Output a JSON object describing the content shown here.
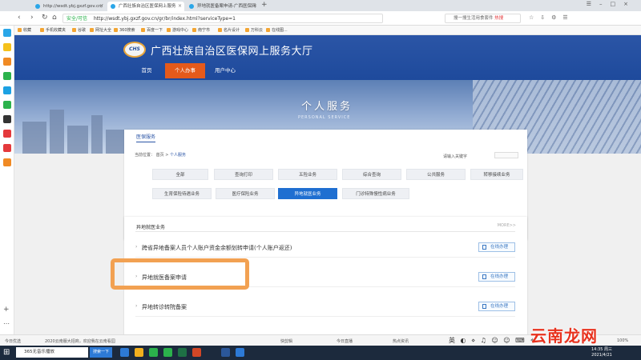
{
  "browser": {
    "tabs": [
      {
        "label": "http://wsdt.ybj.gxzf.gov.cn/",
        "active": false
      },
      {
        "label": "广西壮族自治区医保网上服务",
        "active": true
      },
      {
        "label": "异地就医备案申请-广西医保网",
        "active": false
      }
    ],
    "new_tab": "+",
    "url_secure_label": "安全/可信",
    "url": "http://wsdt.ybj.gxzf.gov.cn/gr/br/index.html?serviceType=1",
    "search_placeholder": "搜一搜生活用食套件",
    "search_hot": "热搜",
    "bookmarks": [
      "收藏",
      "手机收藏夹",
      "谷歌",
      "网址大全",
      "360搜索",
      "百度一下",
      "游戏中心",
      "南宁市",
      "名片设计",
      "万科云",
      "在线图..."
    ]
  },
  "site": {
    "logo_text": "CHS",
    "title": "广西壮族自治区医保网上服务大厅",
    "nav": [
      {
        "label": "首页",
        "active": false
      },
      {
        "label": "个人办事",
        "active": true
      },
      {
        "label": "用户中心",
        "active": false
      }
    ],
    "banner_title": "个人服务",
    "banner_subtitle": "PERSONAL SERVICE"
  },
  "category_panel": {
    "tab": "医保服务",
    "breadcrumb_prefix": "当前位置：",
    "breadcrumb_home": "首页",
    "breadcrumb_sep": ">",
    "breadcrumb_current": "个人服务",
    "keyword_label": "请输入关键字",
    "row1": [
      {
        "label": "全部",
        "active": false
      },
      {
        "label": "查询打印",
        "active": false
      },
      {
        "label": "五险业务",
        "active": false
      },
      {
        "label": "综合查询",
        "active": false
      },
      {
        "label": "公共服务",
        "active": false
      },
      {
        "label": "转移接续业务",
        "active": false
      }
    ],
    "row2": [
      {
        "label": "生育保险待遇业务",
        "active": false
      },
      {
        "label": "医疗保险业务",
        "active": false
      },
      {
        "label": "异地就医业务",
        "active": true
      },
      {
        "label": "门诊特殊慢性病业务",
        "active": false
      }
    ]
  },
  "service_panel": {
    "heading": "异地就医业务",
    "more": "MORE>>",
    "items": [
      {
        "name": "跨省异地备案人员个人账户资金余额划转申请(个人账户返还)",
        "action": "在线办理"
      },
      {
        "name": "异地就医备案申请",
        "action": "在线办理"
      },
      {
        "name": "异地转诊转院备案",
        "action": "在线办理"
      }
    ]
  },
  "statusbar": {
    "left": "今日优选",
    "news": "2020云南服大招商，欢迎我在云南看园",
    "items": [
      "快剪辑",
      "今日直播",
      "热点资讯"
    ],
    "zoom": "100%"
  },
  "taskbar": {
    "search_text": "365无音乐播放",
    "search_button": "搜索一下",
    "time": "14:35 周三",
    "date": "2021/4/21"
  },
  "watermark": "云南龙网"
}
